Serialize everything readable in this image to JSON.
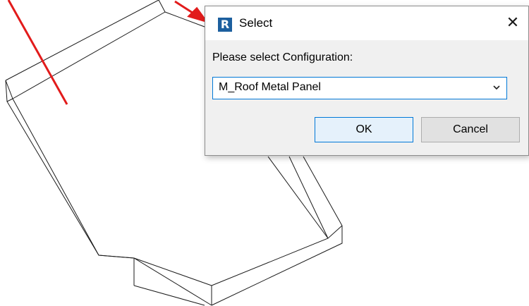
{
  "dialog": {
    "title": "Select",
    "app_icon_letter": "R",
    "close_glyph": "✕",
    "prompt": "Please select Configuration:",
    "configuration": {
      "selected": "M_Roof Metal Panel"
    },
    "ok_label": "OK",
    "cancel_label": "Cancel"
  },
  "icons": {
    "app": "revit-r-icon",
    "close": "close-icon",
    "dropdown": "chevron-down-icon"
  },
  "colors": {
    "arrow": "#e21b1b",
    "accent": "#0078d7",
    "app_icon": "#1c5f9e"
  }
}
